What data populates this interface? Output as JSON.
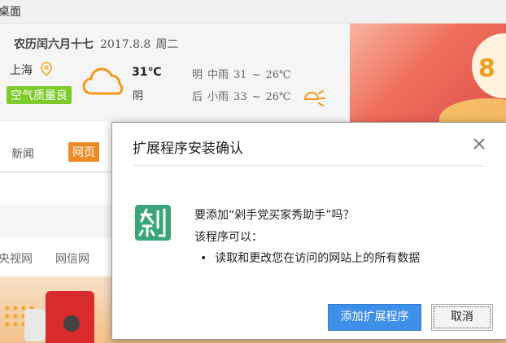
{
  "window": {
    "title": "桌面"
  },
  "weather": {
    "lunar_date": "农历闰六月十七",
    "date": "2017.8.8",
    "weekday": "周二",
    "city": "上海",
    "air_quality": "空气质量良",
    "temp_now": "31℃",
    "condition_now": "阴",
    "forecast": [
      {
        "day": "明",
        "cond": "中雨",
        "high": "31",
        "sep": "~",
        "low": "26℃"
      },
      {
        "day": "后",
        "cond": "小雨",
        "high": "33",
        "sep": "~",
        "low": "26℃"
      }
    ]
  },
  "banner": {
    "text": "8"
  },
  "search": {
    "tabs": [
      {
        "label": "新闻"
      },
      {
        "label": "网页"
      }
    ]
  },
  "links": [
    {
      "label": "央视网"
    },
    {
      "label": "网信网"
    }
  ],
  "dialog": {
    "title": "扩展程序安装确认",
    "question": "要添加“剁手党买家秀助手”吗？",
    "can_label": "该程序可以：",
    "permissions": [
      "读取和更改您在访问的网站上的所有数据"
    ],
    "add_button": "添加扩展程序",
    "cancel_button": "取消"
  },
  "colors": {
    "accent_blue": "#3d8fe8",
    "air_green": "#7ccb2b",
    "tab_orange": "#f08a24",
    "icon_green": "#3aa57a"
  }
}
